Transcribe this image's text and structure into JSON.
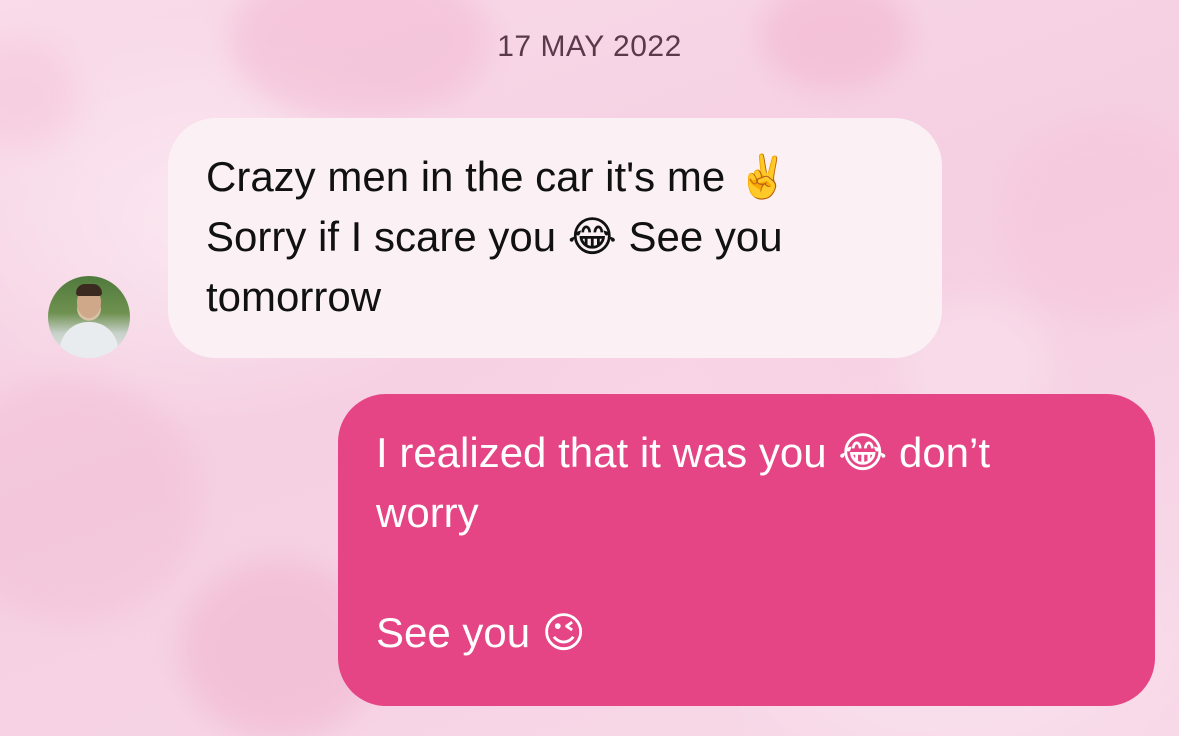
{
  "chat": {
    "date_separator": "17 MAY 2022",
    "messages": [
      {
        "direction": "incoming",
        "lines": [
          "Crazy men in the car it's me ✌️",
          "Sorry if I scare you 😂 See you",
          "tomorrow"
        ]
      },
      {
        "direction": "outgoing",
        "lines": [
          "I realized that it was you 😂 don’t",
          "worry",
          "",
          "See you 😉"
        ]
      }
    ]
  },
  "colors": {
    "incoming_bubble": "#fbf1f4",
    "outgoing_bubble": "#e54585",
    "background": "#f7d5e6"
  },
  "icons": {
    "sender_avatar": "avatar-photo"
  }
}
